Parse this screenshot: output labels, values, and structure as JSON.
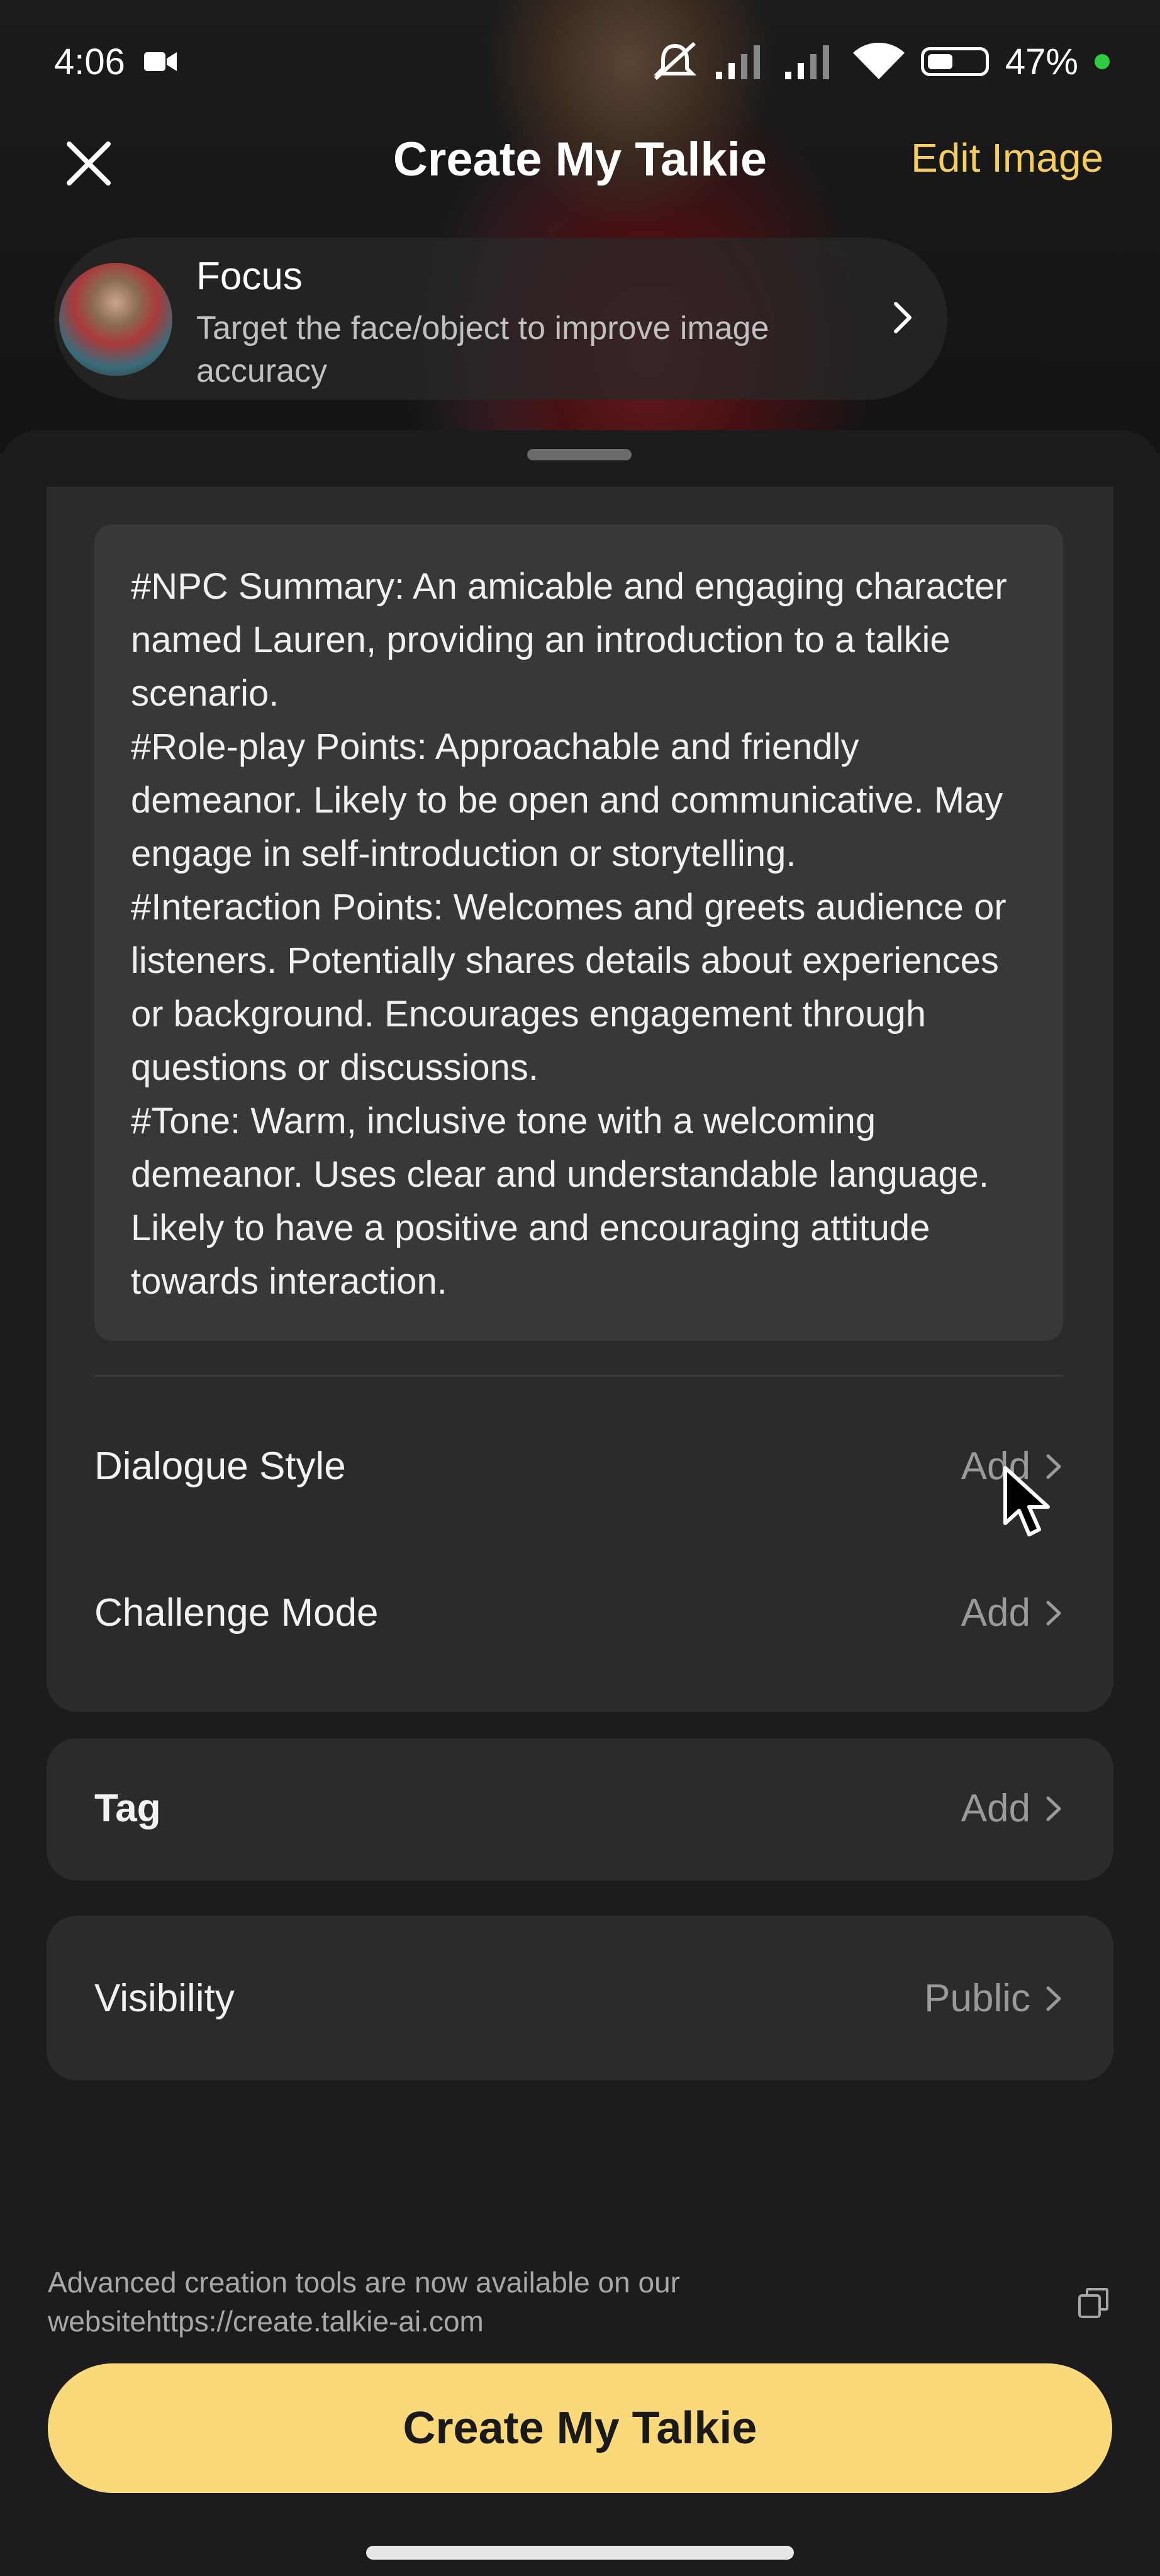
{
  "status_bar": {
    "time": "4:06",
    "battery": "47%",
    "battery_level": 0.47
  },
  "nav": {
    "title": "Create My Talkie",
    "edit_label": "Edit Image"
  },
  "focus": {
    "title": "Focus",
    "subtitle": "Target the face/object to improve image accuracy"
  },
  "description": "#NPC Summary: An amicable and engaging character named Lauren, providing an introduction to a talkie scenario.\n#Role-play Points: Approachable and friendly demeanor. Likely to be open and communicative. May engage in self-introduction or storytelling.\n#Interaction Points: Welcomes and greets audience or listeners. Potentially shares details about experiences or background. Encourages engagement through questions or discussions.\n#Tone: Warm, inclusive tone with a welcoming demeanor. Uses clear and understandable language. Likely to have a positive and encouraging attitude towards interaction.",
  "settings": {
    "dialogue_style": {
      "label": "Dialogue Style",
      "value": "Add"
    },
    "challenge_mode": {
      "label": "Challenge Mode",
      "value": "Add"
    },
    "tag": {
      "label": "Tag",
      "value": "Add"
    },
    "visibility": {
      "label": "Visibility",
      "value": "Public"
    }
  },
  "footer": {
    "note": "Advanced creation tools are now available on our websitehttps://create.talkie-ai.com",
    "cta_label": "Create My Talkie"
  },
  "colors": {
    "accent": "#f5cd5d",
    "cta": "#f9d97a",
    "panel": "#2b2b2d",
    "background": "#1c1c1e"
  },
  "icons": [
    "video-camera-icon",
    "mute-icon",
    "signal-icon",
    "wifi-icon",
    "battery-icon",
    "close-icon",
    "chevron-right-icon",
    "copy-icon",
    "cursor-icon"
  ]
}
